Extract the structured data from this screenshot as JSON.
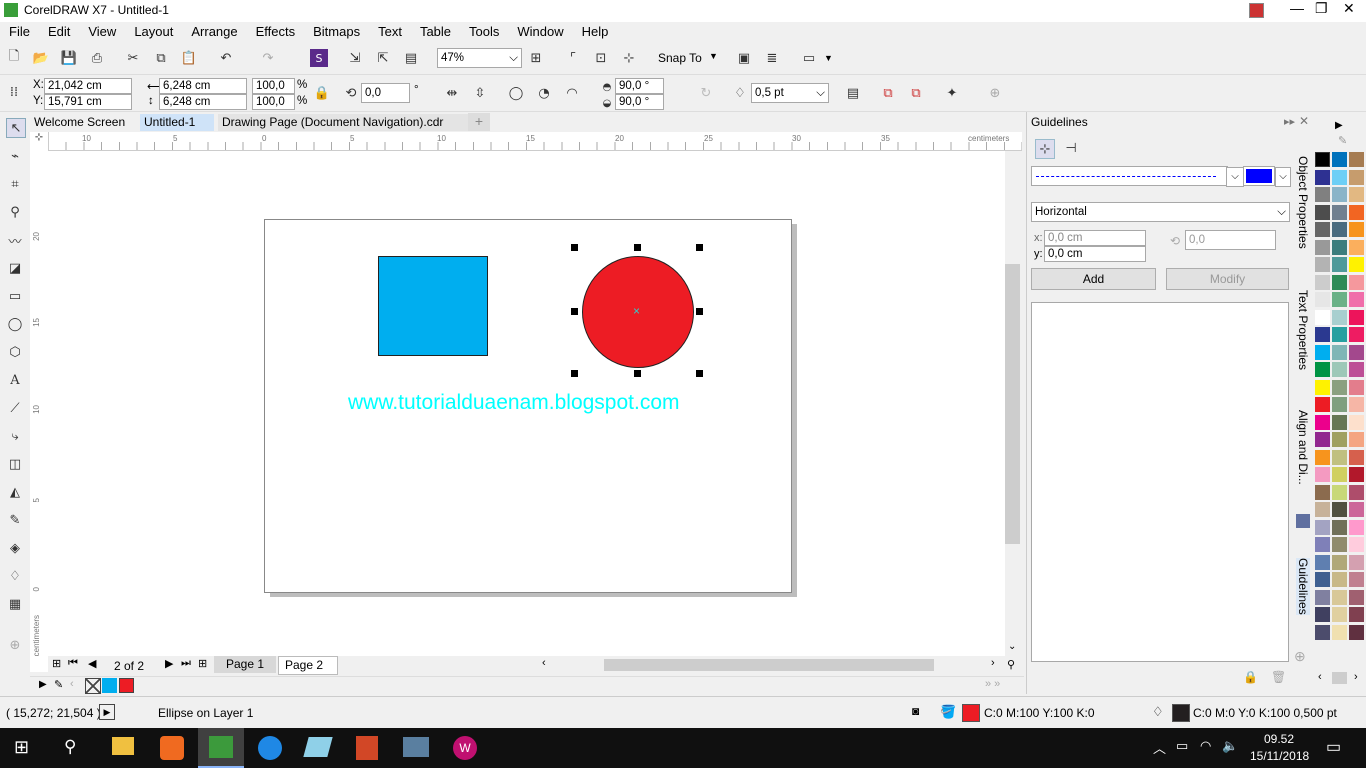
{
  "window": {
    "title": "CorelDRAW X7 - Untitled-1"
  },
  "menu": [
    "File",
    "Edit",
    "View",
    "Layout",
    "Arrange",
    "Effects",
    "Bitmaps",
    "Text",
    "Table",
    "Tools",
    "Window",
    "Help"
  ],
  "toolbar": {
    "zoom": "47%",
    "snap_to": "Snap To"
  },
  "property_bar": {
    "x_label": "X:",
    "x": "21,042 cm",
    "y_label": "Y:",
    "y": "15,791 cm",
    "width": "6,248 cm",
    "height": "6,248 cm",
    "scale_w": "100,0",
    "scale_h": "100,0",
    "pct": "%",
    "rotation": "0,0",
    "deg": "°",
    "angle_start": "90,0 °",
    "angle_end": "90,0 °",
    "outline_width": "0,5 pt"
  },
  "tabs": [
    "Welcome Screen",
    "Untitled-1",
    "Drawing Page (Document Navigation).cdr"
  ],
  "ruler": {
    "unit": "centimeters",
    "h_ticks": [
      "10",
      "5",
      "0",
      "5",
      "10",
      "15",
      "20",
      "25",
      "30",
      "35"
    ],
    "v_ticks": [
      "20",
      "15",
      "10",
      "5",
      "0"
    ]
  },
  "canvas": {
    "text": "www.tutorialduaenam.blogspot.com",
    "square_color": "#00aeef",
    "circle_color": "#ed1c24",
    "text_color": "#00ffff"
  },
  "page_nav": {
    "counter": "2 of 2",
    "pages": [
      "Page 1",
      "Page 2"
    ]
  },
  "docker": {
    "title": "Guidelines",
    "color": "#0000ff",
    "orientation": "Horizontal",
    "x_label": "x:",
    "x": "0,0 cm",
    "y_label": "y:",
    "y": "0,0 cm",
    "angle": "0,0",
    "add": "Add",
    "modify": "Modify",
    "side_tabs": [
      "Object Properties",
      "Text Properties",
      "Align and Di...",
      "Guidelines"
    ]
  },
  "status": {
    "coords": "( 15,272; 21,504 )",
    "object_info": "Ellipse on Layer 1",
    "fill_color": "#ed1c24",
    "fill_text": "C:0 M:100 Y:100 K:0",
    "outline_color": "#231f20",
    "outline_text": "C:0 M:0 Y:0 K:100  0,500 pt"
  },
  "taskbar": {
    "time": "09.52",
    "date": "15/11/2018"
  },
  "palette": [
    "#000000",
    "#2e3192",
    "#808080",
    "#4d4d4d",
    "#666666",
    "#999999",
    "#b3b3b3",
    "#cccccc",
    "#e6e6e6",
    "#ffffff",
    "#2b3990",
    "#00aeef",
    "#009444",
    "#fff200",
    "#ed1c24",
    "#ec008c",
    "#92278f",
    "#f7941d",
    "#f49ac1",
    "#8b6b4e",
    "#c7b299",
    "#a3a3c2",
    "#7f80b8",
    "#5f7fb0",
    "#406090",
    "#8080a0",
    "#404060",
    "#4c4c6c"
  ],
  "palette2": [
    "#0072bc",
    "#6dcff6",
    "#8ab4c8",
    "#708090",
    "#4a6b7f",
    "#3c7d7d",
    "#4f9a9a",
    "#2e8b57",
    "#6ab187",
    "#a8cfcf",
    "#26a0a0",
    "#7fb6b6",
    "#9dc8b8",
    "#8aa080",
    "#7f9f7f",
    "#667755",
    "#a0a060",
    "#c0c080",
    "#d0d060",
    "#c8d878",
    "#505040",
    "#707058",
    "#908c6c",
    "#b0a878",
    "#c8b888",
    "#d8c898",
    "#e0d0a0",
    "#f0e0b0"
  ],
  "palette3": [
    "#a67c52",
    "#c69c6d",
    "#e2b882",
    "#f26522",
    "#f7941d",
    "#fbaf5d",
    "#fff200",
    "#f5989d",
    "#f06eaa",
    "#ed145b",
    "#ee1c62",
    "#a3488d",
    "#bd4f96",
    "#e37d8c",
    "#f6b6a6",
    "#fde0cc",
    "#f4a582",
    "#d6604d",
    "#b2182b",
    "#ae4d6b",
    "#cc6699",
    "#ff99cc",
    "#ffccdd",
    "#d4a0b0",
    "#c08090",
    "#a06070",
    "#804050",
    "#603040"
  ]
}
